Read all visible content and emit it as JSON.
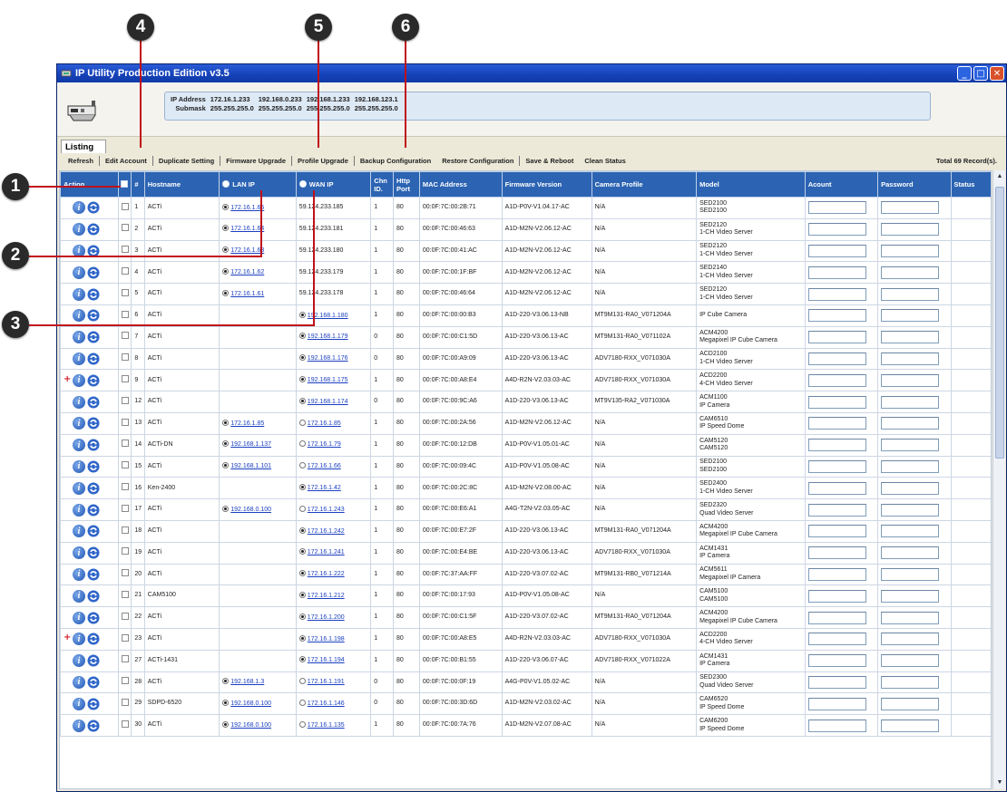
{
  "window": {
    "title": "IP Utility Production Edition v3.5"
  },
  "info": {
    "ip_label": "IP Address",
    "mask_label": "Submask",
    "ips": [
      "172.16.1.233",
      "192.168.0.233",
      "192.168.1.233",
      "192.168.123.1"
    ],
    "masks": [
      "255.255.255.0",
      "255.255.255.0",
      "255.255.255.0",
      "255.255.255.0"
    ]
  },
  "tab": {
    "label": "Listing"
  },
  "toolbar": {
    "items": [
      "Refresh",
      "Edit Account",
      "Duplicate Setting",
      "Firmware Upgrade",
      "Profile Upgrade",
      "Backup Configuration",
      "Restore Configuration",
      "Save & Reboot",
      "Clean Status"
    ],
    "total": "Total 69 Record(s)."
  },
  "callouts": [
    "1",
    "2",
    "3",
    "4",
    "5",
    "6"
  ],
  "columns": {
    "action": "Action",
    "num": "#",
    "hostname": "Hostname",
    "lan_ip": "LAN IP",
    "wan_ip": "WAN IP",
    "chn": "Chn ID.",
    "http": "Http Port",
    "mac": "MAC Address",
    "fw": "Firmware Version",
    "cam": "Camera Profile",
    "model": "Model",
    "account": "Acount",
    "password": "Password",
    "status": "Status"
  },
  "rows": [
    {
      "plus": false,
      "num": "1",
      "host": "ACTi",
      "lan": "172.16.1.65",
      "lan_sel": true,
      "wan": "59.124.233.185",
      "wan_sel": null,
      "chn": "1",
      "http": "80",
      "mac": "00:0F:7C:00:2B:71",
      "fw": "A1D-P0V-V1.04.17-AC",
      "cam": "N/A",
      "m1": "SED2100",
      "m2": "SED2100"
    },
    {
      "plus": false,
      "num": "2",
      "host": "ACTi",
      "lan": "172.16.1.64",
      "lan_sel": true,
      "wan": "59.124.233.181",
      "wan_sel": null,
      "chn": "1",
      "http": "80",
      "mac": "00:0F:7C:00:46:63",
      "fw": "A1D-M2N-V2.06.12-AC",
      "cam": "N/A",
      "m1": "SED2120",
      "m2": "1-CH Video Server"
    },
    {
      "plus": false,
      "num": "3",
      "host": "ACTi",
      "lan": "172.16.1.63",
      "lan_sel": true,
      "wan": "59.124.233.180",
      "wan_sel": null,
      "chn": "1",
      "http": "80",
      "mac": "00:0F:7C:00:41:AC",
      "fw": "A1D-M2N-V2.06.12-AC",
      "cam": "N/A",
      "m1": "SED2120",
      "m2": "1-CH Video Server"
    },
    {
      "plus": false,
      "num": "4",
      "host": "ACTi",
      "lan": "172.16.1.62",
      "lan_sel": true,
      "wan": "59.124.233.179",
      "wan_sel": null,
      "chn": "1",
      "http": "80",
      "mac": "00:0F:7C:00:1F:BF",
      "fw": "A1D-M2N-V2.06.12-AC",
      "cam": "N/A",
      "m1": "SED2140",
      "m2": "1-CH Video Server"
    },
    {
      "plus": false,
      "num": "5",
      "host": "ACTi",
      "lan": "172.16.1.61",
      "lan_sel": true,
      "wan": "59.124.233.178",
      "wan_sel": null,
      "chn": "1",
      "http": "80",
      "mac": "00:0F:7C:00:46:64",
      "fw": "A1D-M2N-V2.06.12-AC",
      "cam": "N/A",
      "m1": "SED2120",
      "m2": "1-CH Video Server"
    },
    {
      "plus": false,
      "num": "6",
      "host": "ACTi",
      "lan": "",
      "lan_sel": null,
      "wan": "192.168.1.180",
      "wan_sel": true,
      "chn": "1",
      "http": "80",
      "mac": "00:0F:7C:00:00:B3",
      "fw": "A1D-220-V3.06.13-NB",
      "cam": "MT9M131-RA0_V071204A",
      "m1": "IP Cube Camera",
      "m2": ""
    },
    {
      "plus": false,
      "num": "7",
      "host": "ACTi",
      "lan": "",
      "lan_sel": null,
      "wan": "192.168.1.179",
      "wan_sel": true,
      "chn": "0",
      "http": "80",
      "mac": "00:0F:7C:00:C1:5D",
      "fw": "A1D-220-V3.06.13-AC",
      "cam": "MT9M131-RA0_V071102A",
      "m1": "ACM4200",
      "m2": "Megapixel IP Cube Camera"
    },
    {
      "plus": false,
      "num": "8",
      "host": "ACTi",
      "lan": "",
      "lan_sel": null,
      "wan": "192.168.1.176",
      "wan_sel": true,
      "chn": "0",
      "http": "80",
      "mac": "00:0F:7C:00:A9:09",
      "fw": "A1D-220-V3.06.13-AC",
      "cam": "ADV7180-RXX_V071030A",
      "m1": "ACD2100",
      "m2": "1-CH Video Server"
    },
    {
      "plus": true,
      "num": "9",
      "host": "ACTi",
      "lan": "",
      "lan_sel": null,
      "wan": "192.168.1.175",
      "wan_sel": true,
      "chn": "1",
      "http": "80",
      "mac": "00:0F:7C:00:A8:E4",
      "fw": "A4D-R2N-V2.03.03-AC",
      "cam": "ADV7180-RXX_V071030A",
      "m1": "ACD2200",
      "m2": "4-CH Video Server"
    },
    {
      "plus": false,
      "num": "12",
      "host": "ACTi",
      "lan": "",
      "lan_sel": null,
      "wan": "192.168.1.174",
      "wan_sel": true,
      "chn": "0",
      "http": "80",
      "mac": "00:0F:7C:00:9C:A6",
      "fw": "A1D-220-V3.06.13-AC",
      "cam": "MT9V135-RA2_V071030A",
      "m1": "ACM1100",
      "m2": "IP Camera"
    },
    {
      "plus": false,
      "num": "13",
      "host": "ACTi",
      "lan": "172.16.1.85",
      "lan_sel": true,
      "wan": "172.16.1.85",
      "wan_sel": false,
      "chn": "1",
      "http": "80",
      "mac": "00:0F:7C:00:2A:56",
      "fw": "A1D-M2N-V2.06.12-AC",
      "cam": "N/A",
      "m1": "CAM6510",
      "m2": "IP Speed Dome"
    },
    {
      "plus": false,
      "num": "14",
      "host": "ACTi-DN",
      "lan": "192.168.1.137",
      "lan_sel": true,
      "wan": "172.16.1.79",
      "wan_sel": false,
      "chn": "1",
      "http": "80",
      "mac": "00:0F:7C:00:12:DB",
      "fw": "A1D-P0V-V1.05.01-AC",
      "cam": "N/A",
      "m1": "CAM5120",
      "m2": "CAM5120"
    },
    {
      "plus": false,
      "num": "15",
      "host": "ACTi",
      "lan": "192.168.1.101",
      "lan_sel": true,
      "wan": "172.16.1.66",
      "wan_sel": false,
      "chn": "1",
      "http": "80",
      "mac": "00:0F:7C:00:09:4C",
      "fw": "A1D-P0V-V1.05.08-AC",
      "cam": "N/A",
      "m1": "SED2100",
      "m2": "SED2100"
    },
    {
      "plus": false,
      "num": "16",
      "host": "Ken-2400",
      "lan": "",
      "lan_sel": null,
      "wan": "172.16.1.42",
      "wan_sel": true,
      "chn": "1",
      "http": "80",
      "mac": "00:0F:7C:00:2C:8C",
      "fw": "A1D-M2N-V2.08.00-AC",
      "cam": "N/A",
      "m1": "SED2400",
      "m2": "1-CH Video Server"
    },
    {
      "plus": false,
      "num": "17",
      "host": "ACTi",
      "lan": "192.168.0.100",
      "lan_sel": true,
      "wan": "172.16.1.243",
      "wan_sel": false,
      "chn": "1",
      "http": "80",
      "mac": "00:0F:7C:00:E6:A1",
      "fw": "A4G-T2N-V2.03.05-AC",
      "cam": "N/A",
      "m1": "SED2320",
      "m2": "Quad Video Server"
    },
    {
      "plus": false,
      "num": "18",
      "host": "ACTi",
      "lan": "",
      "lan_sel": null,
      "wan": "172.16.1.242",
      "wan_sel": true,
      "chn": "1",
      "http": "80",
      "mac": "00:0F:7C:00:E7:2F",
      "fw": "A1D-220-V3.06.13-AC",
      "cam": "MT9M131-RA0_V071204A",
      "m1": "ACM4200",
      "m2": "Megapixel IP Cube Camera"
    },
    {
      "plus": false,
      "num": "19",
      "host": "ACTi",
      "lan": "",
      "lan_sel": null,
      "wan": "172.16.1.241",
      "wan_sel": true,
      "chn": "1",
      "http": "80",
      "mac": "00:0F:7C:00:E4:BE",
      "fw": "A1D-220-V3.06.13-AC",
      "cam": "ADV7180-RXX_V071030A",
      "m1": "ACM1431",
      "m2": "IP Camera"
    },
    {
      "plus": false,
      "num": "20",
      "host": "ACTi",
      "lan": "",
      "lan_sel": null,
      "wan": "172.16.1.222",
      "wan_sel": true,
      "chn": "1",
      "http": "80",
      "mac": "00:0F:7C:37:AA:FF",
      "fw": "A1D-220-V3.07.02-AC",
      "cam": "MT9M131-RB0_V071214A",
      "m1": "ACM5611",
      "m2": "Megapixel IP Camera"
    },
    {
      "plus": false,
      "num": "21",
      "host": "CAM5100",
      "lan": "",
      "lan_sel": null,
      "wan": "172.16.1.212",
      "wan_sel": true,
      "chn": "1",
      "http": "80",
      "mac": "00:0F:7C:00:17:93",
      "fw": "A1D-P0V-V1.05.08-AC",
      "cam": "N/A",
      "m1": "CAM5100",
      "m2": "CAM5100"
    },
    {
      "plus": false,
      "num": "22",
      "host": "ACTi",
      "lan": "",
      "lan_sel": null,
      "wan": "172.16.1.200",
      "wan_sel": true,
      "chn": "1",
      "http": "80",
      "mac": "00:0F:7C:00:C1:5F",
      "fw": "A1D-220-V3.07.02-AC",
      "cam": "MT9M131-RA0_V071204A",
      "m1": "ACM4200",
      "m2": "Megapixel IP Cube Camera"
    },
    {
      "plus": true,
      "num": "23",
      "host": "ACTi",
      "lan": "",
      "lan_sel": null,
      "wan": "172.16.1.198",
      "wan_sel": true,
      "chn": "1",
      "http": "80",
      "mac": "00:0F:7C:00:A8:E5",
      "fw": "A4D-R2N-V2.03.03-AC",
      "cam": "ADV7180-RXX_V071030A",
      "m1": "ACD2200",
      "m2": "4-CH Video Server"
    },
    {
      "plus": false,
      "num": "27",
      "host": "ACTi-1431",
      "lan": "",
      "lan_sel": null,
      "wan": "172.16.1.194",
      "wan_sel": true,
      "chn": "1",
      "http": "80",
      "mac": "00:0F:7C:00:B1:55",
      "fw": "A1D-220-V3.06.07-AC",
      "cam": "ADV7180-RXX_V071022A",
      "m1": "ACM1431",
      "m2": "IP Camera"
    },
    {
      "plus": false,
      "num": "28",
      "host": "ACTi",
      "lan": "192.168.1.3",
      "lan_sel": true,
      "wan": "172.16.1.191",
      "wan_sel": false,
      "chn": "0",
      "http": "80",
      "mac": "00:0F:7C:00:0F:19",
      "fw": "A4G-P0V-V1.05.02-AC",
      "cam": "N/A",
      "m1": "SED2300",
      "m2": "Quad Video Server"
    },
    {
      "plus": false,
      "num": "29",
      "host": "SDPD-6520",
      "lan": "192.168.0.100",
      "lan_sel": true,
      "wan": "172.16.1.146",
      "wan_sel": false,
      "chn": "0",
      "http": "80",
      "mac": "00:0F:7C:00:3D:6D",
      "fw": "A1D-M2N-V2.03.02-AC",
      "cam": "N/A",
      "m1": "CAM6520",
      "m2": "IP Speed Dome"
    },
    {
      "plus": false,
      "num": "30",
      "host": "ACTi",
      "lan": "192.168.0.100",
      "lan_sel": true,
      "wan": "172.16.1.135",
      "wan_sel": false,
      "chn": "1",
      "http": "80",
      "mac": "00:0F:7C:00:7A:76",
      "fw": "A1D-M2N-V2.07.08-AC",
      "cam": "N/A",
      "m1": "CAM6200",
      "m2": "IP Speed Dome"
    }
  ]
}
